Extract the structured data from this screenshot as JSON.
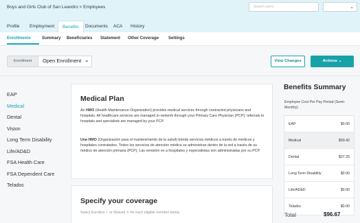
{
  "header": {
    "breadcrumb": "Boys and Girls Club of San Leandro > Employees",
    "search_placeholder": "Search users",
    "dropdown_chevron": "⌄"
  },
  "main_tabs": [
    {
      "label": "Profile"
    },
    {
      "label": "Employment"
    },
    {
      "label": "Benefits"
    },
    {
      "label": "Documents"
    },
    {
      "label": "ACA"
    },
    {
      "label": "History"
    }
  ],
  "sub_tabs": [
    {
      "label": "Enrollments"
    },
    {
      "label": "Summary"
    },
    {
      "label": "Beneficiaries"
    },
    {
      "label": "Statement"
    },
    {
      "label": "Other Coverage"
    },
    {
      "label": "Settings"
    }
  ],
  "controls": {
    "enrollment_label": "Enrollment",
    "enrollment_value": "Open Enrollment",
    "chevron": "⌄",
    "view_changes": "View Changes",
    "actions": "Actions ⌄"
  },
  "sidenav": [
    {
      "label": "EAP"
    },
    {
      "label": "Medical"
    },
    {
      "label": "Dental"
    },
    {
      "label": "Vision"
    },
    {
      "label": "Long Term Disability"
    },
    {
      "label": "Life/AD&D"
    },
    {
      "label": "FSA Health Care"
    },
    {
      "label": "FSA Dependent Care"
    },
    {
      "label": "Teladoc"
    }
  ],
  "plan": {
    "title": "Medical Plan",
    "p1_bold": "HMO",
    "p1_pre": "An ",
    "p1_rest": " (Health Maintenance Organization) provides medical services through contracted physicians and hospitals. All healthcare services are managed in-network through your Primary Care Physician (PCP); referrals to hospitals and specialists are managed by your PCP.",
    "p2_bold": "Una HMO",
    "p2_rest": " (Organización para el mantenimiento de la salud) brinda servicios médicos a través de médicos y hospitales contratados.  Todos los servicios de atención médica se administran dentro de la red a través de su médico de atención primaria (PCP); Las remisión es a hospitales y especialistas son administradas por su PCP."
  },
  "coverage": {
    "title": "Specify your coverage",
    "text": "Select Enrolled ✓ or Waived ✕ for each eligible member below."
  },
  "summary": {
    "title": "Benefits Summary",
    "subtitle": "Employee Cost Per Pay Period (Semi-Monthly)",
    "rows": [
      {
        "name": "EAP",
        "value": "$0.00"
      },
      {
        "name": "Medical",
        "value": "$59.42"
      },
      {
        "name": "Dental",
        "value": "$37.25"
      },
      {
        "name": "Long Term Disability",
        "value": "$0.00"
      },
      {
        "name": "Life/AD&D",
        "value": "$0.00"
      },
      {
        "name": "Teladoc",
        "value": "$0.00"
      }
    ],
    "total_label": "Total",
    "total_value": "$96.67"
  },
  "colors": {
    "accent": "#1aa3b5",
    "header_bg": "#dff3f9",
    "actions_bg": "#17a2a8"
  }
}
